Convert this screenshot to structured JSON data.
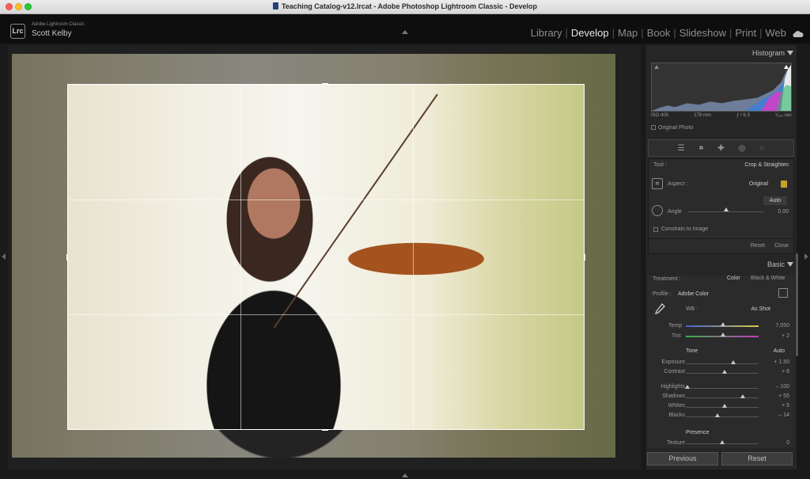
{
  "window": {
    "title": "Teaching Catalog-v12.lrcat - Adobe Photoshop Lightroom Classic - Develop"
  },
  "identity": {
    "logo": "Lrc",
    "app_name": "Adobe Lightroom Classic",
    "user": "Scott Kelby"
  },
  "modules": [
    "Library",
    "Develop",
    "Map",
    "Book",
    "Slideshow",
    "Print",
    "Web"
  ],
  "active_module": "Develop",
  "histogram": {
    "title": "Histogram",
    "iso": "ISO 400",
    "focal": "178 mm",
    "aperture": "ƒ / 6.3",
    "shutter": "¹⁄₁₆₀ sec",
    "original_photo": "Original Photo"
  },
  "crop": {
    "tool_label": "Tool :",
    "tool_name": "Crop & Straighten",
    "aspect_label": "Aspect :",
    "aspect_value": "Original",
    "auto_label": "Auto",
    "angle_label": "Angle",
    "angle_value": "0.00",
    "angle_level": 0.5,
    "constrain_label": "Constrain to Image",
    "reset_label": "Reset",
    "close_label": "Close"
  },
  "basic": {
    "title": "Basic",
    "treatment_label": "Treatment :",
    "treatment_color": "Color",
    "treatment_bw": "Black & White",
    "profile_label": "Profile :",
    "profile_value": "Adobe Color",
    "wb_label": "WB :",
    "wb_value": "As Shot",
    "temp_label": "Temp",
    "temp_value": "7,050",
    "tint_label": "Tint",
    "tint_value": "+ 2",
    "tone_label": "Tone",
    "tone_auto": "Auto",
    "sliders": [
      {
        "label": "Exposure",
        "value": "+ 1.50",
        "level": 0.65
      },
      {
        "label": "Contrast",
        "value": "+ 6",
        "level": 0.53
      },
      {
        "label": "Highlights",
        "value": "– 100",
        "level": 0.02
      },
      {
        "label": "Shadows",
        "value": "+ 55",
        "level": 0.78
      },
      {
        "label": "Whites",
        "value": "+ 5",
        "level": 0.53
      },
      {
        "label": "Blacks",
        "value": "– 14",
        "level": 0.43
      }
    ],
    "presence_label": "Presence",
    "texture_label": "Texture",
    "texture_value": "0"
  },
  "buttons": {
    "previous": "Previous",
    "reset": "Reset"
  },
  "colors": {
    "panel_bg": "#262626",
    "accent_lock": "#c9a326"
  }
}
